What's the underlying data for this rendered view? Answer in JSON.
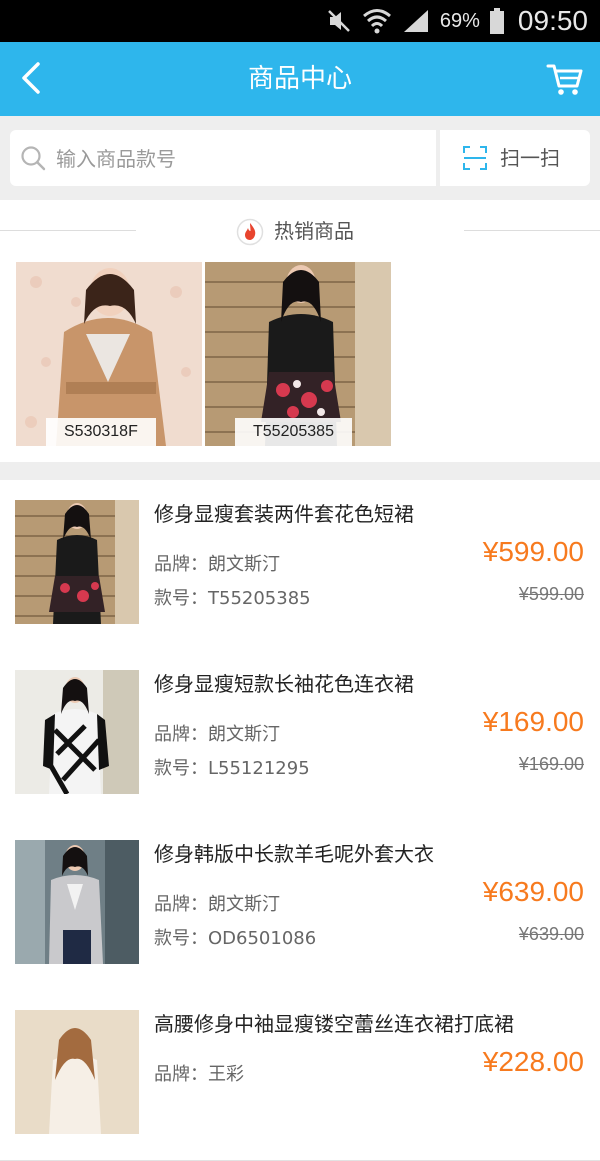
{
  "status_bar": {
    "battery_percent": "69%",
    "time": "09:50",
    "icons": [
      "mute-icon",
      "wifi-icon",
      "signal-icon",
      "battery-icon"
    ]
  },
  "header": {
    "title": "商品中心",
    "back_icon": "chevron-left-icon",
    "cart_icon": "cart-icon",
    "background_color": "#2eb6ec"
  },
  "search": {
    "placeholder": "输入商品款号",
    "value": "",
    "scan_label": "扫一扫"
  },
  "hot": {
    "title": "热销商品",
    "items": [
      {
        "sku": "S530318F"
      },
      {
        "sku": "T55205385"
      }
    ]
  },
  "products": [
    {
      "name": "修身显瘦套装两件套花色短裙",
      "brand": "品牌：朗文斯汀",
      "sku": "款号：T55205385",
      "price": "¥599.00",
      "original_price": "¥599.00"
    },
    {
      "name": "修身显瘦短款长袖花色连衣裙",
      "brand": "品牌：朗文斯汀",
      "sku": "款号：L55121295",
      "price": "¥169.00",
      "original_price": "¥169.00"
    },
    {
      "name": "修身韩版中长款羊毛呢外套大衣",
      "brand": "品牌：朗文斯汀",
      "sku": "款号：OD6501086",
      "price": "¥639.00",
      "original_price": "¥639.00"
    },
    {
      "name": "高腰修身中袖显瘦镂空蕾丝连衣裙打底裙",
      "brand": "品牌：王彩",
      "sku": "",
      "price": "¥228.00",
      "original_price": ""
    }
  ],
  "colors": {
    "accent": "#2eb6ec",
    "price": "#f77a1e"
  }
}
